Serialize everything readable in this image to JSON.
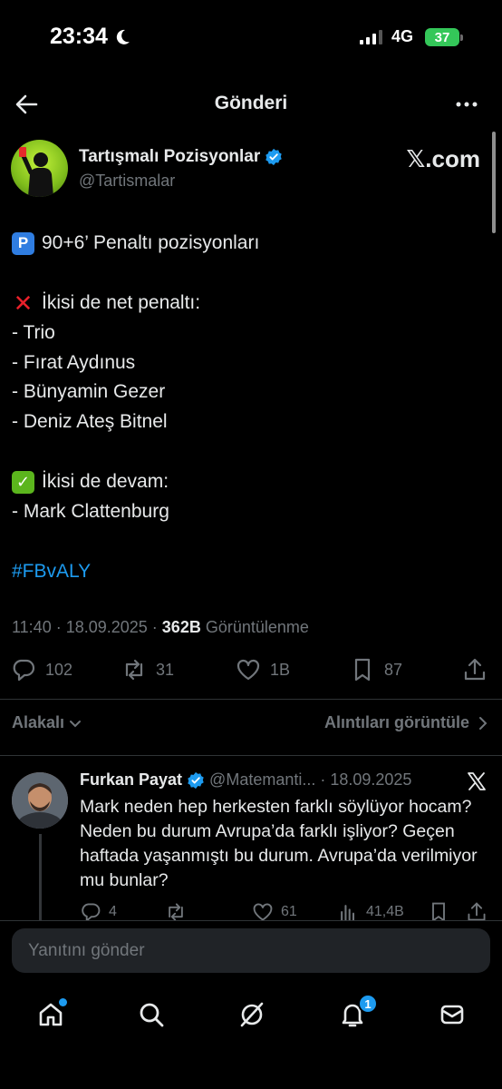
{
  "status_bar": {
    "time": "23:34",
    "network": "4G",
    "battery": "37"
  },
  "header": {
    "title": "Gönderi"
  },
  "author": {
    "name": "Tartışmalı Pozisyonlar",
    "handle": "@Tartismalar",
    "source": "𝕏.com"
  },
  "tweet": {
    "lines": [
      "90+6’ Penaltı pozisyonları",
      "",
      "İkisi de net penaltı:",
      "- Trio",
      "- Fırat Aydınus",
      "- Bünyamin Gezer",
      "- Deniz Ateş Bitnel",
      "",
      "İkisi de devam:",
      "- Mark Clattenburg",
      "",
      "#FBvALY"
    ],
    "emoji_p": "P",
    "emoji_x": "✕",
    "emoji_check": "✓"
  },
  "meta": {
    "time_date": "11:40 · 18.09.2025 · ",
    "views_count": "362B",
    "views_label": " Görüntülenme"
  },
  "actions": {
    "replies": "102",
    "reposts": "31",
    "likes": "1B",
    "bookmarks": "87"
  },
  "sort": {
    "label": "Alakalı",
    "quotes_link": "Alıntıları görüntüle"
  },
  "reply": {
    "name": "Furkan Payat",
    "handle": "@Matemanti...",
    "date": "· 18.09.2025",
    "text": "Mark neden hep herkesten farklı söylüyor hocam? Neden bu durum Avrupa’da farklı işliyor? Geçen haftada yaşanmıştı bu durum. Avrupa’da verilmiyor mu bunlar?",
    "replies": "4",
    "likes": "61",
    "views": "41,4B"
  },
  "composer": {
    "placeholder": "Yanıtını gönder"
  },
  "nav": {
    "notifications_count": "1"
  },
  "colors": {
    "accent": "#1d9bf0",
    "muted": "#71767b",
    "text": "#e7e9ea",
    "background": "#000000"
  }
}
